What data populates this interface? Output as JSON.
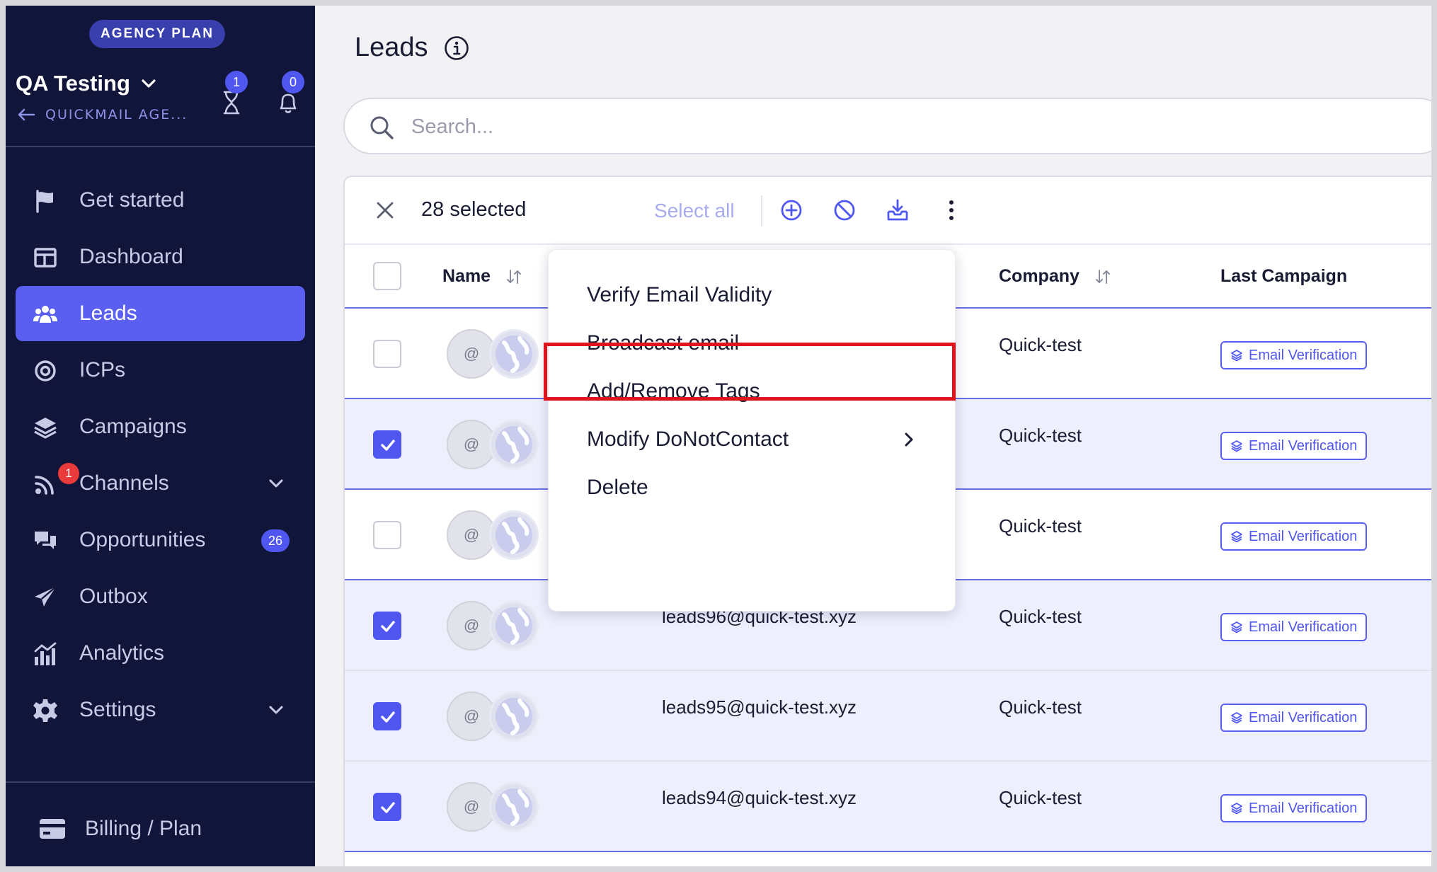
{
  "sidebar": {
    "plan_badge": "AGENCY PLAN",
    "workspace_name": "QA Testing",
    "back_link": "QUICKMAIL AGE...",
    "pending_count": "1",
    "notifications_count": "0",
    "nav": [
      {
        "label": "Get started",
        "icon": "flag-icon"
      },
      {
        "label": "Dashboard",
        "icon": "dashboard-icon"
      },
      {
        "label": "Leads",
        "icon": "users-icon",
        "active": true
      },
      {
        "label": "ICPs",
        "icon": "target-icon"
      },
      {
        "label": "Campaigns",
        "icon": "layers-icon"
      },
      {
        "label": "Channels",
        "icon": "rss-icon",
        "badge": "1"
      },
      {
        "label": "Opportunities",
        "icon": "chat-icon",
        "count": "26"
      },
      {
        "label": "Outbox",
        "icon": "send-icon"
      },
      {
        "label": "Analytics",
        "icon": "analytics-icon"
      },
      {
        "label": "Settings",
        "icon": "gear-icon"
      }
    ],
    "billing_label": "Billing / Plan"
  },
  "main": {
    "title": "Leads",
    "search_placeholder": "Search...",
    "toolbar": {
      "selected_text": "28 selected",
      "select_all": "Select all"
    },
    "columns": {
      "name": "Name",
      "company": "Company",
      "last_campaign": "Last Campaign"
    },
    "rows": [
      {
        "checked": false,
        "email": "",
        "company": "Quick-test",
        "campaign": "Email Verification"
      },
      {
        "checked": true,
        "email": "",
        "company": "Quick-test",
        "campaign": "Email Verification"
      },
      {
        "checked": false,
        "email": "",
        "company": "Quick-test",
        "campaign": "Email Verification"
      },
      {
        "checked": true,
        "email": "leads96@quick-test.xyz",
        "company": "Quick-test",
        "campaign": "Email Verification"
      },
      {
        "checked": true,
        "email": "leads95@quick-test.xyz",
        "company": "Quick-test",
        "campaign": "Email Verification"
      },
      {
        "checked": true,
        "email": "leads94@quick-test.xyz",
        "company": "Quick-test",
        "campaign": "Email Verification"
      }
    ],
    "avatar_symbol": "@"
  },
  "menu": {
    "items": [
      {
        "label": "Verify Email Validity"
      },
      {
        "label": "Broadcast email",
        "highlighted": true
      },
      {
        "label": "Add/Remove Tags"
      },
      {
        "label": "Modify DoNotContact",
        "submenu": true
      },
      {
        "label": "Delete"
      }
    ]
  },
  "colors": {
    "sidebar_bg": "#12153a",
    "accent": "#5a5ff2",
    "highlight": "#e0141c"
  }
}
